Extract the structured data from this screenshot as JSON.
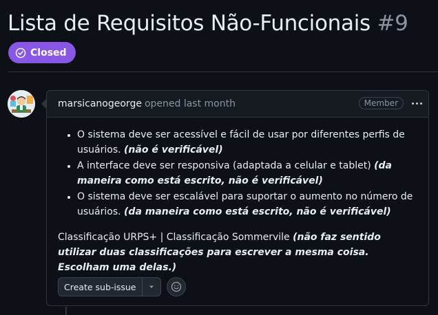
{
  "issue": {
    "title": "Lista de Requisitos Não-Funcionais",
    "number": "#9",
    "state_label": "Closed",
    "state_color": "#8957e5"
  },
  "comment": {
    "author": "marsicanogeorge",
    "meta": "opened last month",
    "role_badge": "Member",
    "avatar_icon": "user-avatar",
    "bullets": [
      {
        "text": "O sistema deve ser acessível e fácil de usar por diferentes perfis de usuários. ",
        "emphasis": "(não é verificável)"
      },
      {
        "text": "A interface deve ser responsiva (adaptada a celular e tablet) ",
        "emphasis": "(da maneira como está escrito, não é verificável)"
      },
      {
        "text": "O sistema deve ser escalável para suportar o aumento no número de usuários. ",
        "emphasis": "(da maneira como está escrito, não é verificável)"
      }
    ],
    "paragraph_text": "Classificação URPS+ | Classificação Sommervile ",
    "paragraph_emphasis": "(não faz sentido utilizar duas classificações para escrever a mesma coisa. Escolham uma delas.)"
  },
  "actions": {
    "create_sub_issue": "Create sub-issue"
  }
}
